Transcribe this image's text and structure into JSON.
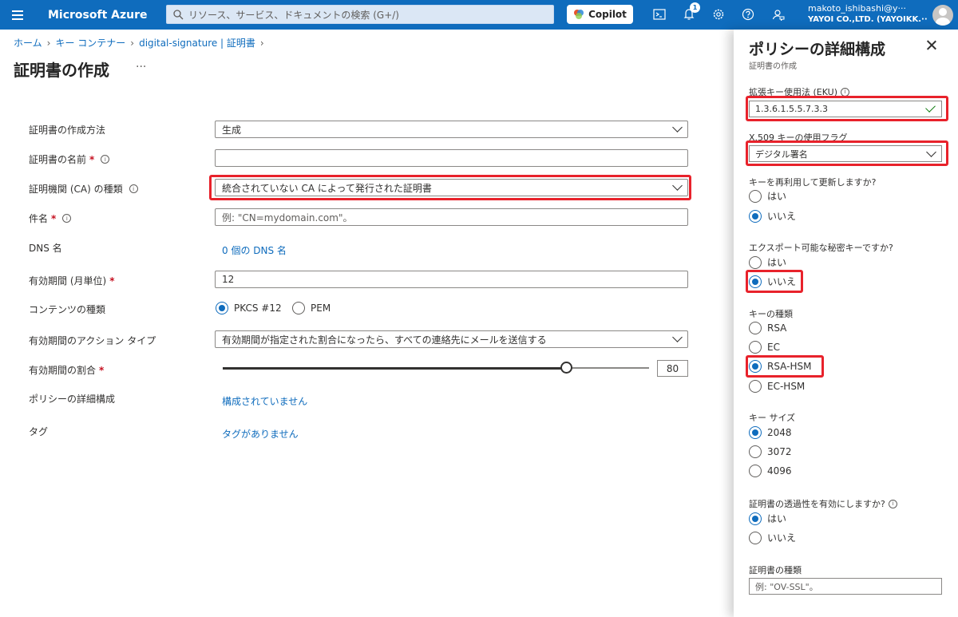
{
  "topbar": {
    "brand": "Microsoft Azure",
    "search_placeholder": "リソース、サービス、ドキュメントの検索 (G+/)",
    "copilot": "Copilot",
    "notification_count": "1",
    "user_name": "makoto_ishibashi@y···",
    "user_org": "YAYOI CO.,LTD. (YAYOIKK.···"
  },
  "breadcrumb": [
    "ホーム",
    "キー コンテナー",
    "digital-signature | 証明書"
  ],
  "page_title": "証明書の作成",
  "more": "···",
  "form": {
    "method_label": "証明書の作成方法",
    "method_value": "生成",
    "name_label": "証明書の名前",
    "name_value": "",
    "ca_label": "証明機関 (CA) の種類",
    "ca_value": "統合されていない CA によって発行された証明書",
    "subject_label": "件名",
    "subject_placeholder": "例: \"CN=mydomain.com\"。",
    "dns_label": "DNS 名",
    "dns_link": "0 個の DNS 名",
    "validity_label": "有効期間 (月単位)",
    "validity_value": "12",
    "content_label": "コンテンツの種類",
    "content_opt1": "PKCS #12",
    "content_opt2": "PEM",
    "action_label": "有効期間のアクション タイプ",
    "action_value": "有効期間が指定された割合になったら、すべての連絡先にメールを送信する",
    "percent_label": "有効期間の割合",
    "percent_value": "80",
    "policy_label": "ポリシーの詳細構成",
    "policy_link": "構成されていません",
    "tags_label": "タグ",
    "tags_link": "タグがありません",
    "required_mark": "*"
  },
  "panel": {
    "title": "ポリシーの詳細構成",
    "subtitle": "証明書の作成",
    "eku_label": "拡張キー使用法 (EKU)",
    "eku_value": "1.3.6.1.5.5.7.3.3",
    "x509_label": "X.509 キーの使用フラグ",
    "x509_value": "デジタル署名",
    "reuse_label": "キーを再利用して更新しますか?",
    "yes": "はい",
    "no": "いいえ",
    "export_label": "エクスポート可能な秘密キーですか?",
    "keytype_label": "キーの種類",
    "kt_rsa": "RSA",
    "kt_ec": "EC",
    "kt_rsahsm": "RSA-HSM",
    "kt_echsm": "EC-HSM",
    "keysize_label": "キー サイズ",
    "ks1": "2048",
    "ks2": "3072",
    "ks3": "4096",
    "transparency_label": "証明書の透過性を有効にしますか?",
    "certtype_label": "証明書の種類",
    "certtype_placeholder": "例: \"OV-SSL\"。"
  }
}
